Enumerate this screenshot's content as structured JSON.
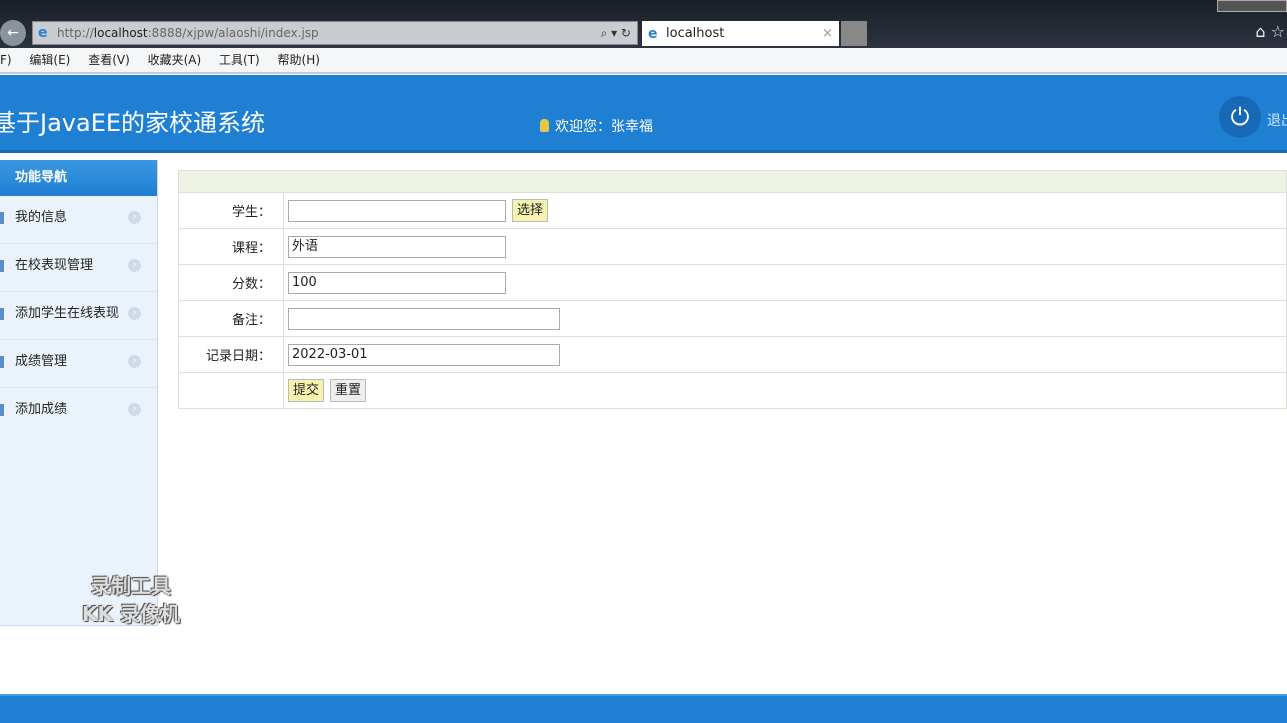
{
  "browser": {
    "url_prefix": "http://",
    "url_host": "localhost",
    "url_rest": ":8888/xjpw/alaoshi/index.jsp",
    "tab_title": "localhost",
    "tab_close": "×",
    "search_refresh": "⌕ ▾ ↻",
    "back": "←"
  },
  "menu": [
    "F)",
    "编辑(E)",
    "查看(V)",
    "收藏夹(A)",
    "工具(T)",
    "帮助(H)"
  ],
  "header": {
    "title": "基于JavaEE的家校通系统",
    "welcome": "欢迎您：张幸福",
    "logout": "退出",
    "power": "⏻"
  },
  "sidebar": {
    "title": "功能导航",
    "items": [
      {
        "label": "我的信息"
      },
      {
        "label": "在校表现管理"
      },
      {
        "label": "添加学生在线表现"
      },
      {
        "label": "成绩管理"
      },
      {
        "label": "添加成绩"
      }
    ]
  },
  "form": {
    "student_label": "学生：",
    "student_value": "",
    "select_btn": "选择",
    "course_label": "课程：",
    "course_value": "外语",
    "score_label": "分数：",
    "score_value": "100",
    "remark_label": "备注：",
    "remark_value": "",
    "date_label": "记录日期：",
    "date_value": "2022-03-01",
    "submit": "提交",
    "reset": "重置"
  },
  "watermark": [
    "录制工具",
    "KK 录像机"
  ]
}
